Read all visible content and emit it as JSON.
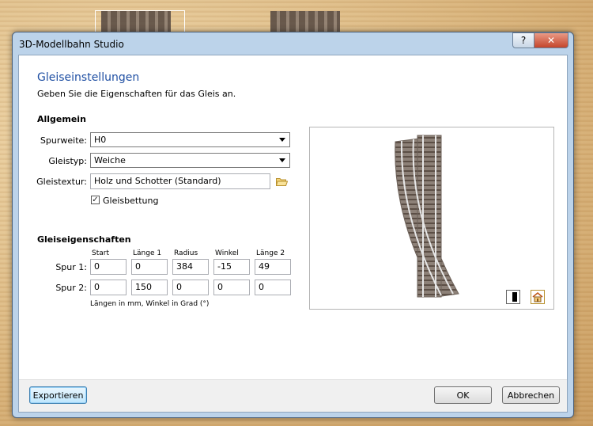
{
  "window": {
    "title": "3D-Modellbahn Studio",
    "help_label": "?",
    "close_label": "✕"
  },
  "page": {
    "heading": "Gleiseinstellungen",
    "subheading": "Geben Sie die Eigenschaften für das Gleis an."
  },
  "general": {
    "section_label": "Allgemein",
    "gauge": {
      "label": "Spurweite:",
      "value": "H0"
    },
    "track_type": {
      "label": "Gleistyp:",
      "value": "Weiche"
    },
    "texture": {
      "label": "Gleistextur:",
      "value": "Holz und Schotter (Standard)"
    },
    "bedding": {
      "label": "Gleisbettung",
      "checked": true,
      "check_glyph": "✓"
    }
  },
  "properties": {
    "section_label": "Gleiseigenschaften",
    "columns": [
      "Start",
      "Länge 1",
      "Radius",
      "Winkel",
      "Länge 2"
    ],
    "rows": [
      {
        "label": "Spur 1:",
        "values": [
          "0",
          "0",
          "384",
          "-15",
          "49"
        ]
      },
      {
        "label": "Spur 2:",
        "values": [
          "0",
          "150",
          "0",
          "0",
          "0"
        ]
      }
    ],
    "note": "Längen in mm, Winkel in Grad (°)"
  },
  "footer": {
    "export_label": "Exportieren",
    "ok_label": "OK",
    "cancel_label": "Abbrechen"
  },
  "icons": {
    "folder": "folder-icon",
    "view_toggle": "split-view-icon",
    "station": "station-icon"
  },
  "colors": {
    "heading": "#1f4fa3",
    "titlebar": "#bcd3ea",
    "close": "#c4452b"
  }
}
